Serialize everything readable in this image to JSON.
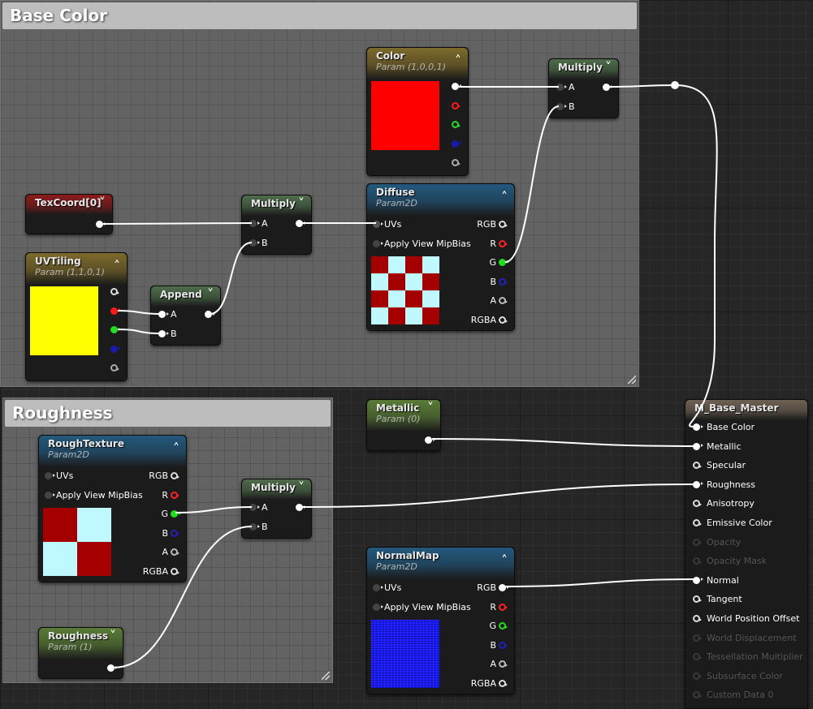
{
  "comments": [
    {
      "title": "Base Color"
    },
    {
      "title": "Roughness"
    }
  ],
  "nodes": {
    "color": {
      "title": "Color",
      "subtitle": "Param (1,0,0,1)",
      "swatch": "#ff0000"
    },
    "multiply_top": {
      "title": "Multiply",
      "inputs": [
        "A",
        "B"
      ]
    },
    "texcoord": {
      "title": "TexCoord[0]"
    },
    "multiply_mid": {
      "title": "Multiply",
      "inputs": [
        "A",
        "B"
      ]
    },
    "diffuse": {
      "title": "Diffuse",
      "subtitle": "Param2D",
      "inputs": [
        "UVs",
        "Apply View MipBias"
      ],
      "outputs": [
        "RGB",
        "R",
        "G",
        "B",
        "A",
        "RGBA"
      ],
      "checker": [
        "#a50000",
        "#bff8ff"
      ]
    },
    "uvtiling": {
      "title": "UVTiling",
      "subtitle": "Param (1,1,0,1)",
      "swatch": "#ffff00"
    },
    "append": {
      "title": "Append",
      "inputs": [
        "A",
        "B"
      ]
    },
    "metallic": {
      "title": "Metallic",
      "subtitle": "Param (0)"
    },
    "roughtexture": {
      "title": "RoughTexture",
      "subtitle": "Param2D",
      "inputs": [
        "UVs",
        "Apply View MipBias"
      ],
      "outputs": [
        "RGB",
        "R",
        "G",
        "B",
        "A",
        "RGBA"
      ],
      "checker": [
        "#a50000",
        "#bff8ff"
      ]
    },
    "multiply_low": {
      "title": "Multiply",
      "inputs": [
        "A",
        "B"
      ]
    },
    "normalmap": {
      "title": "NormalMap",
      "subtitle": "Param2D",
      "inputs": [
        "UVs",
        "Apply View MipBias"
      ],
      "outputs": [
        "RGB",
        "R",
        "G",
        "B",
        "A",
        "RGBA"
      ],
      "texture_color": "#1a1aff"
    },
    "roughness": {
      "title": "Roughness",
      "subtitle": "Param (1)"
    },
    "master": {
      "title": "M_Base_Master",
      "inputs": [
        {
          "label": "Base Color",
          "state": "connected"
        },
        {
          "label": "Metallic",
          "state": "connected"
        },
        {
          "label": "Specular",
          "state": "open"
        },
        {
          "label": "Roughness",
          "state": "connected"
        },
        {
          "label": "Anisotropy",
          "state": "open"
        },
        {
          "label": "Emissive Color",
          "state": "open"
        },
        {
          "label": "Opacity",
          "state": "disabled"
        },
        {
          "label": "Opacity Mask",
          "state": "disabled"
        },
        {
          "label": "Normal",
          "state": "connected"
        },
        {
          "label": "Tangent",
          "state": "open"
        },
        {
          "label": "World Position Offset",
          "state": "open"
        },
        {
          "label": "World Displacement",
          "state": "disabled"
        },
        {
          "label": "Tessellation Multiplier",
          "state": "disabled"
        },
        {
          "label": "Subsurface Color",
          "state": "disabled"
        },
        {
          "label": "Custom Data 0",
          "state": "disabled"
        }
      ]
    }
  },
  "colors": {
    "header_vector_param": "#7d6a2c",
    "header_texcoord": "#8c1c1c",
    "header_math": "#4e6c4a",
    "header_texture": "#23587c",
    "header_scalar_param": "#5a7c37",
    "header_master": "#6f6254",
    "wire": "#ffffff"
  },
  "icons": {
    "collapse": "chevron-up-icon",
    "expand": "chevron-down-icon"
  }
}
